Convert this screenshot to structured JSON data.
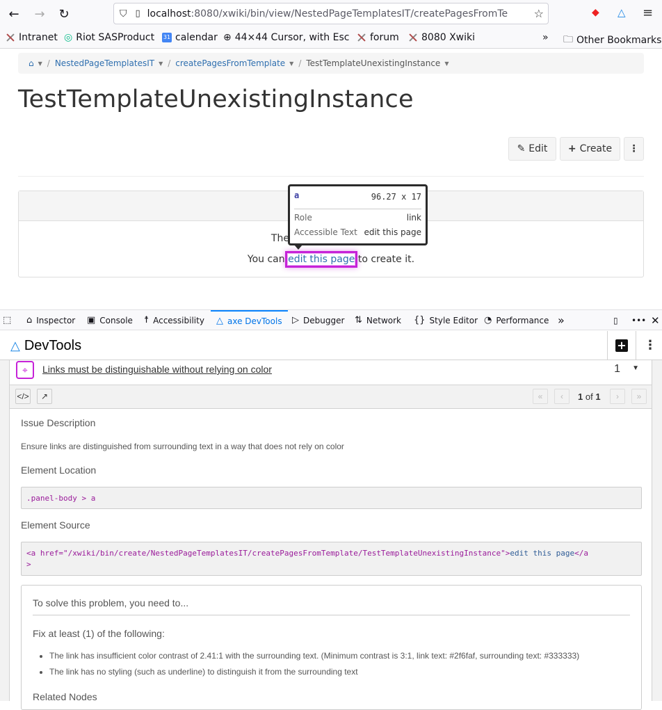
{
  "browser": {
    "url_host": "localhost",
    "url_path": ":8080/xwiki/bin/view/NestedPageTemplatesIT/createPagesFromTe",
    "bookmarks": [
      {
        "label": "Intranet",
        "icon": "xwiki-icon"
      },
      {
        "label": "Riot SASProduct",
        "icon": "riot-icon"
      },
      {
        "label": "calendar",
        "icon": "calendar-icon"
      },
      {
        "label": "44×44 Cursor, with Esc",
        "icon": "globe-icon"
      },
      {
        "label": "forum",
        "icon": "xwiki-icon"
      },
      {
        "label": "8080 Xwiki",
        "icon": "xwiki-icon"
      }
    ],
    "other_bookmarks": "Other Bookmarks"
  },
  "page": {
    "breadcrumb": [
      "NestedPageTemplatesIT",
      "createPagesFromTemplate",
      "TestTemplateUnexistingInstance"
    ],
    "title": "TestTemplateUnexistingInstance",
    "buttons": {
      "edit": "Edit",
      "create": "Create"
    },
    "panel": {
      "line1_visible": "The reques",
      "line2_prefix": "You can",
      "link_text": "edit this page",
      "line2_suffix": "to create it."
    },
    "tooltip": {
      "tag": "a",
      "dims": "96.27 x 17",
      "role_label": "Role",
      "role_value": "link",
      "acc_label": "Accessible Text",
      "acc_value": "edit this page"
    }
  },
  "devtools": {
    "tabs": [
      "Inspector",
      "Console",
      "Accessibility",
      "axe DevTools",
      "Debugger",
      "Network",
      "Style Editor",
      "Performance"
    ],
    "active_tab": "axe DevTools",
    "axe_title": "DevTools",
    "issue": {
      "title": "Links must be distinguishable without relying on color",
      "count": "1",
      "pager_current": "1",
      "pager_of": "of",
      "pager_total": "1",
      "desc_heading": "Issue Description",
      "desc": "Ensure links are distinguished from surrounding text in a way that does not rely on color",
      "location_heading": "Element Location",
      "location": ".panel-body > a",
      "source_heading": "Element Source",
      "source_tag": "<a href=\"/xwiki/bin/create/NestedPageTemplatesIT/createPagesFromTemplate/TestTemplateUnexistingInstance\">",
      "source_text": "edit this page",
      "source_close1": "</a",
      "source_close2": ">",
      "solve_heading": "To solve this problem, you need to...",
      "fix_heading": "Fix at least (1) of the following:",
      "fixes": [
        "The link has insufficient color contrast of 2.41:1 with the surrounding text. (Minimum contrast is 3:1, link text: #2f6faf, surrounding text: #333333)",
        "The link has no styling (such as underline) to distinguish it from the surrounding text"
      ],
      "related_heading": "Related Nodes"
    }
  },
  "colors": {
    "link": "#2f6faf",
    "text": "#333333",
    "highlight": "#c622d8",
    "devtools_accent": "#0a84ff"
  }
}
